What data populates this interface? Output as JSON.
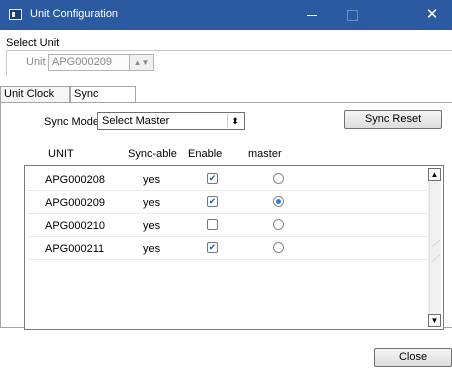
{
  "window": {
    "title": "Unit Configuration",
    "minimize_glyph": "—",
    "close_glyph": "✕"
  },
  "select_unit": {
    "group_label": "Select Unit",
    "unit_label": "Unit",
    "unit_value": "APG000209",
    "spin_glyph": "▲▼"
  },
  "tabs": [
    {
      "label": "Unit Clock",
      "selected": false
    },
    {
      "label": "Sync control",
      "selected": true
    }
  ],
  "sync": {
    "mode_label": "Sync Mode",
    "mode_value": "Select Master",
    "mode_arrow": "⬍",
    "reset_label": "Sync Reset"
  },
  "table": {
    "headers": [
      "UNIT",
      "Sync-able",
      "Enable",
      "master"
    ],
    "rows": [
      {
        "unit": "APG000208",
        "syncable": "yes",
        "enabled": true,
        "master": false
      },
      {
        "unit": "APG000209",
        "syncable": "yes",
        "enabled": true,
        "master": true
      },
      {
        "unit": "APG000210",
        "syncable": "yes",
        "enabled": false,
        "master": false
      },
      {
        "unit": "APG000211",
        "syncable": "yes",
        "enabled": true,
        "master": false
      }
    ]
  },
  "scrollbar": {
    "up_glyph": "▲",
    "down_glyph": "▼"
  },
  "check_glyph": "✔",
  "footer": {
    "close_label": "Close"
  },
  "colors": {
    "titlebar": "#2b5aa0",
    "radio_selected": "#2b7fe0",
    "check": "#1f5fa8"
  }
}
